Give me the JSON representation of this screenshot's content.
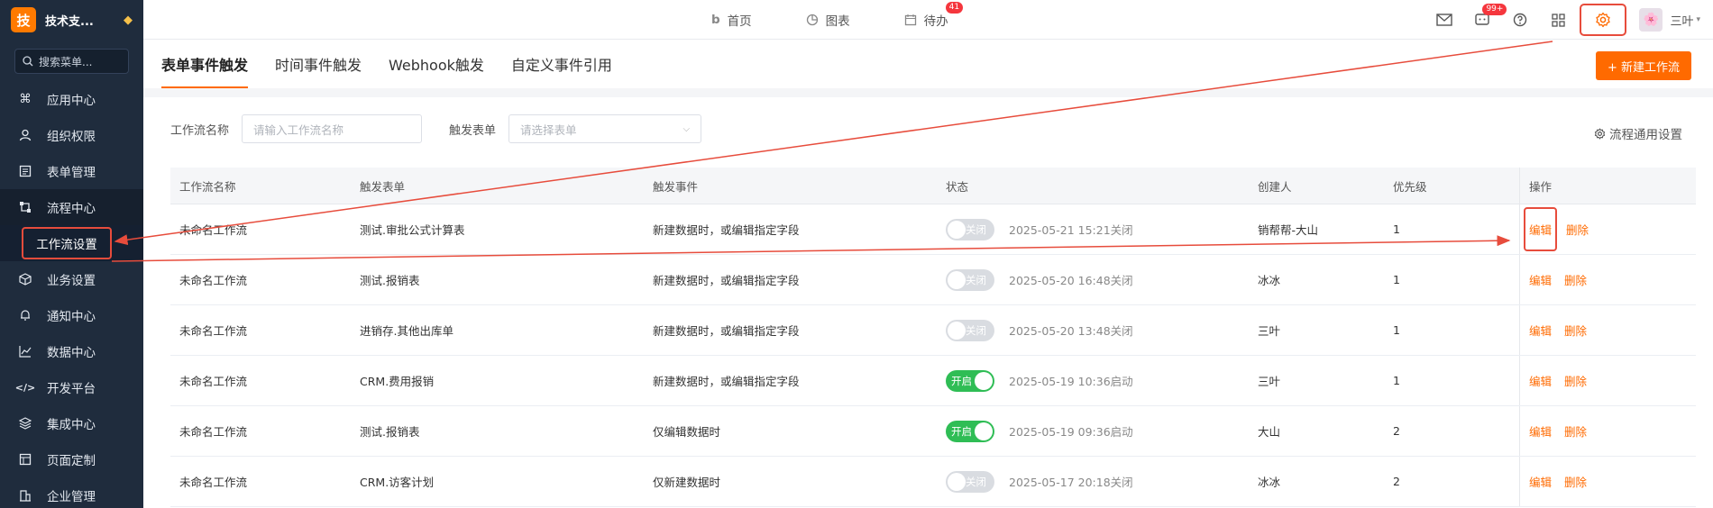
{
  "sidebar": {
    "logo_char": "技",
    "brand": "技术支...",
    "search_placeholder": "搜索菜单...",
    "items": [
      {
        "label": "应用中心",
        "icon": "command-icon"
      },
      {
        "label": "组织权限",
        "icon": "user-icon"
      },
      {
        "label": "表单管理",
        "icon": "form-icon"
      },
      {
        "label": "流程中心",
        "icon": "flow-icon"
      },
      {
        "label": "业务设置",
        "icon": "cube-icon"
      },
      {
        "label": "通知中心",
        "icon": "bell-icon"
      },
      {
        "label": "数据中心",
        "icon": "chart-icon"
      },
      {
        "label": "开发平台",
        "icon": "code-icon"
      },
      {
        "label": "集成中心",
        "icon": "layers-icon"
      },
      {
        "label": "页面定制",
        "icon": "layout-icon"
      },
      {
        "label": "企业管理",
        "icon": "building-icon"
      }
    ],
    "submenu_active": "工作流设置"
  },
  "topbar": {
    "nav": [
      {
        "label": "首页",
        "icon": "home-icon"
      },
      {
        "label": "图表",
        "icon": "pie-icon"
      },
      {
        "label": "待办",
        "icon": "calendar-icon",
        "badge": "41"
      }
    ],
    "message_badge": "99+",
    "user_name": "三叶",
    "avatar_emoji": "🌸"
  },
  "tabs": [
    "表单事件触发",
    "时间事件触发",
    "Webhook触发",
    "自定义事件引用"
  ],
  "active_tab": "表单事件触发",
  "new_button": "+ 新建工作流",
  "filters": {
    "name_label": "工作流名称",
    "name_placeholder": "请输入工作流名称",
    "form_label": "触发表单",
    "form_placeholder": "请选择表单"
  },
  "general_settings": "流程通用设置",
  "table": {
    "headers": [
      "工作流名称",
      "触发表单",
      "触发事件",
      "状态",
      "创建人",
      "优先级",
      "操作"
    ],
    "rows": [
      {
        "name": "未命名工作流",
        "form": "测试.审批公式计算表",
        "event": "新建数据时，或编辑指定字段",
        "toggle": "关闭",
        "on": false,
        "status": "2025-05-21 15:21关闭",
        "creator": "销帮帮-大山",
        "priority": "1"
      },
      {
        "name": "未命名工作流",
        "form": "测试.报销表",
        "event": "新建数据时，或编辑指定字段",
        "toggle": "关闭",
        "on": false,
        "status": "2025-05-20 16:48关闭",
        "creator": "冰冰",
        "priority": "1"
      },
      {
        "name": "未命名工作流",
        "form": "进销存.其他出库单",
        "event": "新建数据时，或编辑指定字段",
        "toggle": "关闭",
        "on": false,
        "status": "2025-05-20 13:48关闭",
        "creator": "三叶",
        "priority": "1"
      },
      {
        "name": "未命名工作流",
        "form": "CRM.费用报销",
        "event": "新建数据时，或编辑指定字段",
        "toggle": "开启",
        "on": true,
        "status": "2025-05-19 10:36启动",
        "creator": "三叶",
        "priority": "1"
      },
      {
        "name": "未命名工作流",
        "form": "测试.报销表",
        "event": "仅编辑数据时",
        "toggle": "开启",
        "on": true,
        "status": "2025-05-19 09:36启动",
        "creator": "大山",
        "priority": "2"
      },
      {
        "name": "未命名工作流",
        "form": "CRM.访客计划",
        "event": "仅新建数据时",
        "toggle": "关闭",
        "on": false,
        "status": "2025-05-17 20:18关闭",
        "creator": "冰冰",
        "priority": "2"
      }
    ],
    "edit_label": "编辑",
    "delete_label": "删除"
  },
  "colors": {
    "accent": "#ff6a00",
    "sidebar": "#1f2c3d",
    "annotation": "#e74c3c",
    "toggle_on": "#2fbd55"
  }
}
